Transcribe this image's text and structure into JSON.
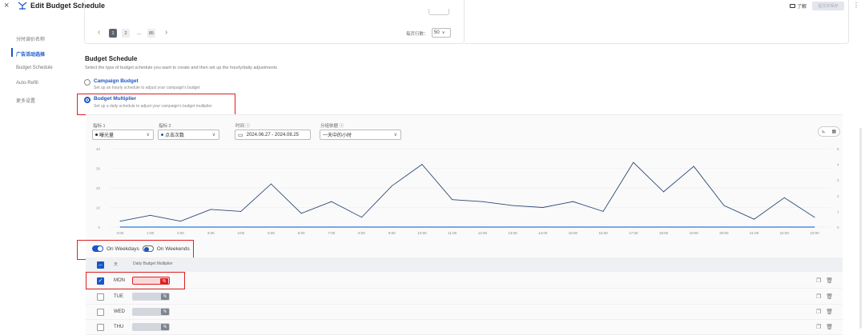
{
  "header": {
    "close": "×",
    "title": "Edit Budget Schedule",
    "learn": "了解",
    "save": "提交并保存",
    "more": "⋮"
  },
  "sidebar": {
    "items": [
      {
        "label": "分时调价名称",
        "active": false
      },
      {
        "label": "广告活动选择",
        "active": true
      },
      {
        "label": "Budget Schedule",
        "active": false
      },
      {
        "label": "Auto-Refill",
        "active": false
      },
      {
        "label": "更多设置",
        "active": false
      }
    ]
  },
  "pager": {
    "prev": "‹",
    "pages": [
      "1",
      "2",
      "...",
      "85"
    ],
    "next": "›",
    "per_page_label": "每页行数：",
    "per_page_value": "50"
  },
  "schedule": {
    "title": "Budget Schedule",
    "desc": "Select the type of budget schedule you want to create and then set up the hourly/daily adjustments",
    "options": [
      {
        "title": "Campaign Budget",
        "desc": "Set up an hourly schedule to adjust your campaign's budget",
        "checked": false
      },
      {
        "title": "Budget Multiplier",
        "desc": "Set up a daily schedule to adjust your campaign's budget multiplier",
        "checked": true
      }
    ]
  },
  "filters": {
    "metric1_label": "指标 1",
    "metric1_value": "曝光量",
    "metric2_label": "指标 2",
    "metric2_value": "点击次数",
    "time_label": "时间 ⓘ",
    "time_value": "2024.06.27 - 2024.08.25",
    "group_label": "分组依据 ⓘ",
    "group_value": "一天中的小时"
  },
  "chart_data": {
    "type": "line",
    "categories": [
      "0:00",
      "1:00",
      "2:00",
      "3:00",
      "4:00",
      "5:00",
      "6:00",
      "7:00",
      "8:00",
      "9:00",
      "10:00",
      "11:00",
      "12:00",
      "13:00",
      "14:00",
      "15:00",
      "16:00",
      "17:00",
      "18:00",
      "19:00",
      "20:00",
      "21:00",
      "22:00",
      "23:00"
    ],
    "series": [
      {
        "values": [
          3,
          6,
          3,
          9,
          8,
          22,
          7,
          13,
          5,
          21,
          32,
          14,
          13,
          11,
          10,
          13,
          8,
          33,
          18,
          31,
          11,
          4,
          15,
          5
        ],
        "color": "#2c4a78"
      },
      {
        "values": [
          0,
          0,
          0,
          0,
          0,
          0,
          0,
          0,
          0,
          0,
          0,
          0,
          0,
          0,
          0,
          0,
          0,
          0,
          0,
          0,
          0,
          0,
          0,
          0
        ],
        "color": "#4a90e2"
      }
    ],
    "y_left_ticks": [
      "0",
      "10",
      "20",
      "30",
      "40"
    ],
    "y_right_ticks": [
      "0",
      "1",
      "2",
      "3",
      "4",
      "5"
    ],
    "ylim": [
      0,
      40
    ],
    "grid": true
  },
  "toggles": {
    "weekdays": "On Weekdays",
    "weekends": "On Weekends"
  },
  "table": {
    "headers": {
      "day": "天",
      "multiplier": "Daily Budget Multiplier"
    },
    "rows": [
      {
        "day": "MON",
        "checked": true,
        "error": true
      },
      {
        "day": "TUE",
        "checked": false,
        "error": false
      },
      {
        "day": "WED",
        "checked": false,
        "error": false
      },
      {
        "day": "THU",
        "checked": false,
        "error": false
      }
    ],
    "pct": "%"
  }
}
